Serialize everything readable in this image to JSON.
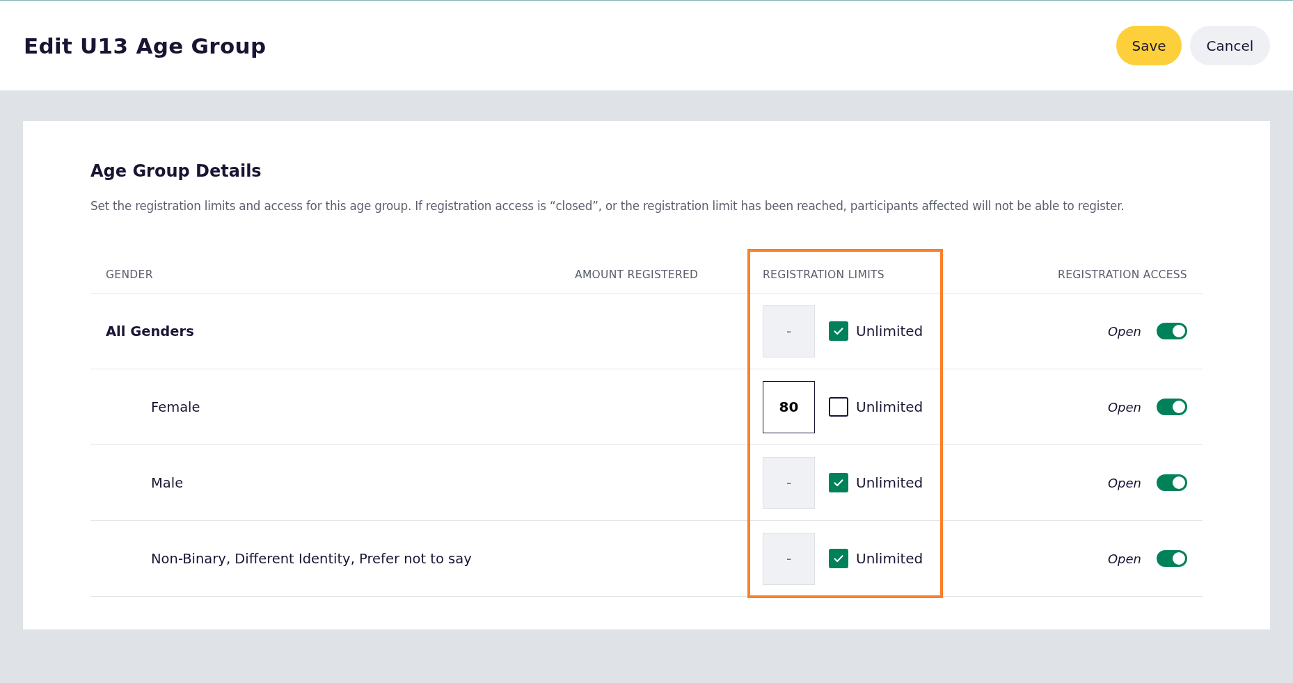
{
  "header": {
    "title": "Edit U13 Age Group",
    "buttons": [
      {
        "label": "Save",
        "kind": "primary"
      },
      {
        "label": "Cancel",
        "kind": "secondary"
      }
    ]
  },
  "section": {
    "title": "Age Group Details",
    "description": "Set the registration limits and access for this age group. If registration access is “closed”, or the registration limit has been reached, participants affected will not be able to register."
  },
  "table": {
    "columns": [
      {
        "label": "GENDER",
        "highlighted": false
      },
      {
        "label": "AMOUNT REGISTERED",
        "highlighted": false
      },
      {
        "label": "REGISTRATION LIMITS",
        "highlighted": true
      },
      {
        "label": "REGISTRATION ACCESS",
        "highlighted": false
      }
    ],
    "rows": [
      {
        "gender": "All Genders",
        "limit": {
          "placeholder": "-",
          "disabled": true
        },
        "unlimited": {
          "label": "Unlimited",
          "checked": true
        },
        "access": {
          "label": "Open",
          "on": true
        },
        "children": [
          {
            "gender": "Female",
            "limit": {
              "value": "80",
              "disabled": false
            },
            "unlimited": {
              "label": "Unlimited",
              "checked": false
            },
            "access": {
              "label": "Open",
              "on": true
            }
          },
          {
            "gender": "Male",
            "limit": {
              "placeholder": "-",
              "disabled": true
            },
            "unlimited": {
              "label": "Unlimited",
              "checked": true
            },
            "access": {
              "label": "Open",
              "on": true
            }
          },
          {
            "gender": "Non-Binary, Different Identity, Prefer not to say",
            "limit": {
              "placeholder": "-",
              "disabled": true
            },
            "unlimited": {
              "label": "Unlimited",
              "checked": true
            },
            "access": {
              "label": "Open",
              "on": true
            }
          }
        ]
      }
    ]
  }
}
